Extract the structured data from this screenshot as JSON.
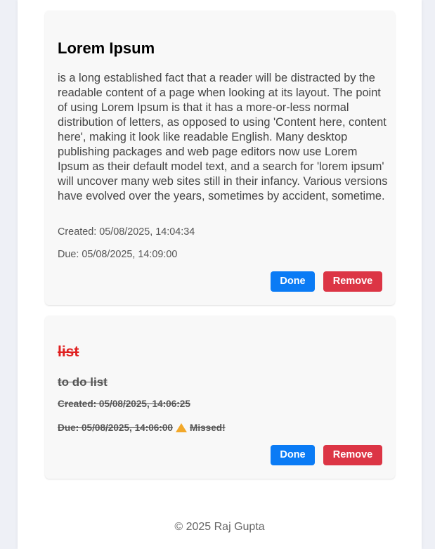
{
  "tasks": [
    {
      "title": "Lorem Ipsum",
      "description": "is a long established fact that a reader will be distracted by the readable content of a page when looking at its layout. The point of using Lorem Ipsum is that it has a more-or-less normal distribution of letters, as opposed to using 'Content here, content here', making it look like readable English. Many desktop publishing packages and web page editors now use Lorem Ipsum as their default model text, and a search for 'lorem ipsum' will uncover many web sites still in their infancy. Various versions have evolved over the years, sometimes by accident, sometime.",
      "created": "Created: 05/08/2025, 14:04:34",
      "due": "Due: 05/08/2025, 14:09:00",
      "done_label": "Done",
      "remove_label": "Remove",
      "completed": false
    },
    {
      "title": "list",
      "description": "to do list",
      "created": "Created: 05/08/2025, 14:06:25",
      "due": "Due: 05/08/2025, 14:06:00",
      "status_icon": "warning-icon",
      "status": "Missed!",
      "done_label": "Done",
      "remove_label": "Remove",
      "completed": true
    }
  ],
  "footer": {
    "text": "© 2025 Raj Gupta"
  },
  "colors": {
    "done_button": "#0a7bf5",
    "remove_button": "#dc3545",
    "completed_title": "#e02020",
    "warning": "#f2a82a"
  }
}
